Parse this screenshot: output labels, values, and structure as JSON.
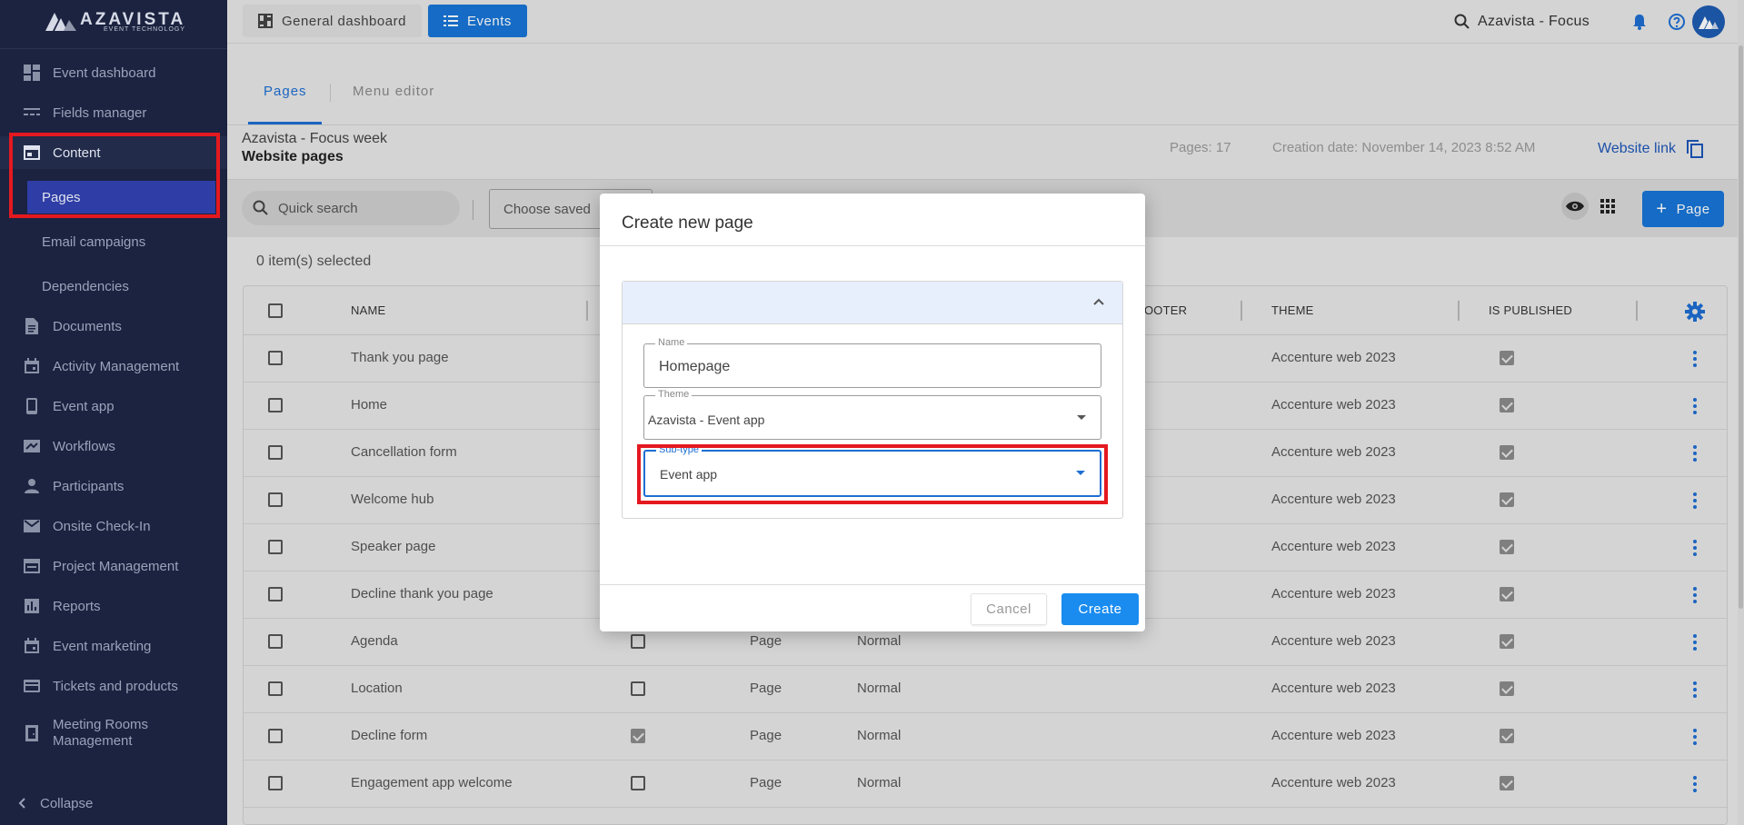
{
  "brand": {
    "name": "AZAVISTA",
    "tagline": "EVENT TECHNOLOGY"
  },
  "sidebar": {
    "items": [
      {
        "label": "Event dashboard",
        "icon": "dashboard-icon"
      },
      {
        "label": "Fields manager",
        "icon": "fields-icon"
      },
      {
        "label": "Content",
        "icon": "content-icon"
      },
      {
        "label": "Pages"
      },
      {
        "label": "Email campaigns"
      },
      {
        "label": "Dependencies"
      },
      {
        "label": "Documents",
        "icon": "document-icon"
      },
      {
        "label": "Activity Management",
        "icon": "calendar-icon"
      },
      {
        "label": "Event app",
        "icon": "phone-icon"
      },
      {
        "label": "Workflows",
        "icon": "workflow-icon"
      },
      {
        "label": "Participants",
        "icon": "person-icon"
      },
      {
        "label": "Onsite Check-In",
        "icon": "mail-icon"
      },
      {
        "label": "Project Management",
        "icon": "project-icon"
      },
      {
        "label": "Reports",
        "icon": "reports-icon"
      },
      {
        "label": "Event marketing",
        "icon": "calendar-icon"
      },
      {
        "label": "Tickets and products",
        "icon": "card-icon"
      },
      {
        "label": "Meeting Rooms",
        "label2": "Management",
        "icon": "meeting-room-icon"
      }
    ],
    "collapse_label": "Collapse"
  },
  "topbar": {
    "general_dashboard": "General dashboard",
    "events": "Events",
    "event_name": "Azavista - Focus",
    "avatar_initial": "A"
  },
  "tabs": {
    "pages": "Pages",
    "menu_editor": "Menu editor"
  },
  "header": {
    "event_title": "Azavista - Focus week",
    "section_title": "Website pages",
    "pages_count": "Pages: 17",
    "creation_date": "Creation date: November 14, 2023 8:52 AM",
    "website_link": "Website link"
  },
  "toolbar": {
    "search_placeholder": "Quick search",
    "saved_filter": "Choose saved",
    "add_page": "Page"
  },
  "selection": {
    "count_text": "0 item(s) selected"
  },
  "table": {
    "columns": {
      "name": "NAME",
      "footer": "OOTER",
      "theme": "THEME",
      "is_published": "IS PUBLISHED"
    },
    "rows": [
      {
        "name": "Thank you page",
        "checked": null,
        "type": "",
        "mode": "",
        "theme": "Accenture web 2023",
        "published": true
      },
      {
        "name": "Home",
        "checked": null,
        "type": "",
        "mode": "",
        "theme": "Accenture web 2023",
        "published": true
      },
      {
        "name": "Cancellation form",
        "checked": null,
        "type": "",
        "mode": "",
        "theme": "Accenture web 2023",
        "published": true
      },
      {
        "name": "Welcome hub",
        "checked": null,
        "type": "",
        "mode": "",
        "theme": "Accenture web 2023",
        "published": true
      },
      {
        "name": "Speaker page",
        "checked": null,
        "type": "",
        "mode": "",
        "theme": "Accenture web 2023",
        "published": true
      },
      {
        "name": "Decline thank you page",
        "checked": null,
        "type": "",
        "mode": "",
        "theme": "Accenture web 2023",
        "published": true
      },
      {
        "name": "Agenda",
        "checked": false,
        "type": "Page",
        "mode": "Normal",
        "theme": "Accenture web 2023",
        "published": true
      },
      {
        "name": "Location",
        "checked": false,
        "type": "Page",
        "mode": "Normal",
        "theme": "Accenture web 2023",
        "published": true
      },
      {
        "name": "Decline form",
        "checked": true,
        "type": "Page",
        "mode": "Normal",
        "theme": "Accenture web 2023",
        "published": true
      },
      {
        "name": "Engagement app welcome",
        "checked": false,
        "type": "Page",
        "mode": "Normal",
        "theme": "Accenture web 2023",
        "published": true
      }
    ]
  },
  "modal": {
    "title": "Create new page",
    "name_label": "Name",
    "name_value": "Homepage",
    "theme_label": "Theme",
    "theme_value": "Azavista - Event app",
    "subtype_label": "Sub-type",
    "subtype_value": "Event app",
    "cancel": "Cancel",
    "create": "Create"
  },
  "colors": {
    "accent": "#1775d6",
    "sidebar": "#1b2340",
    "highlight": "#e4191f"
  }
}
